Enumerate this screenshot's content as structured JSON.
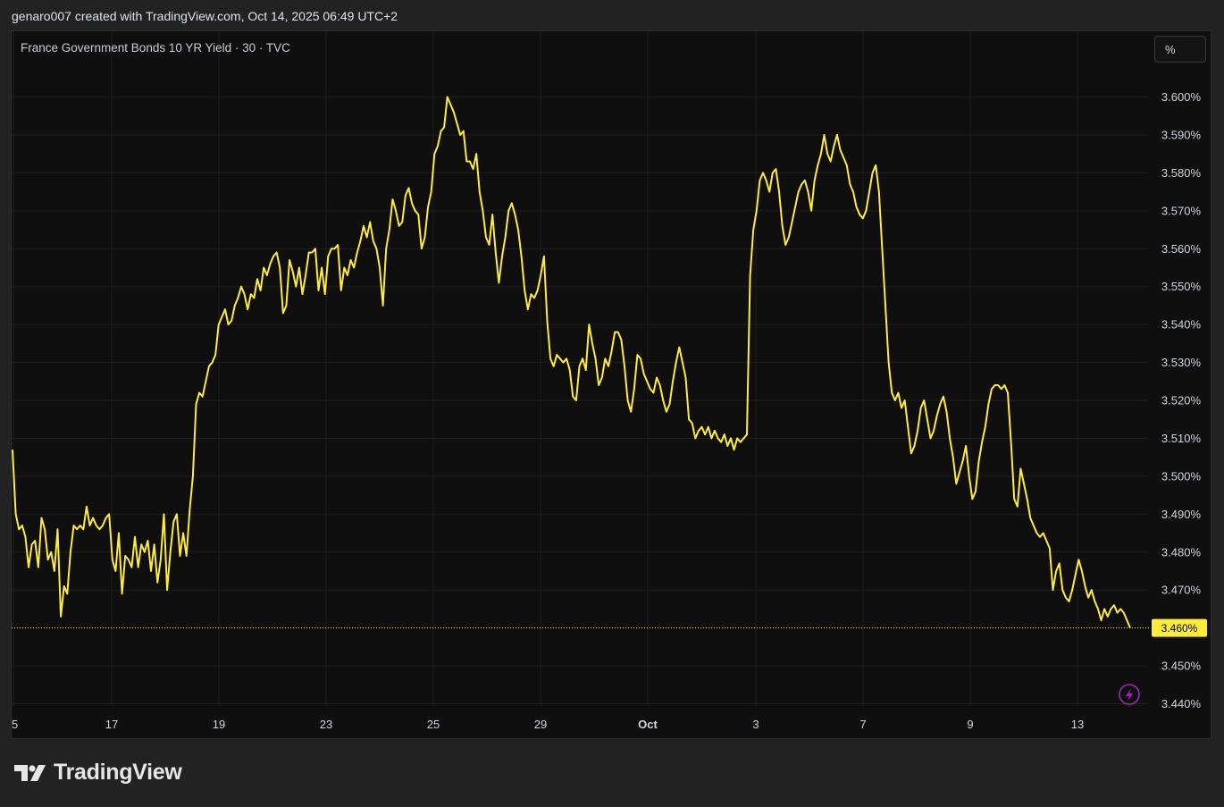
{
  "header": {
    "attribution": "genaro007 created with TradingView.com, Oct 14, 2025 06:49 UTC+2"
  },
  "legend": {
    "series_title": "France Government Bonds 10 YR Yield · 30 · TVC"
  },
  "controls": {
    "unit_label": "%"
  },
  "footer": {
    "logo_text": "TradingView",
    "logo_icon": "tradingview-logo-icon"
  },
  "colors": {
    "background": "#0f0f0f",
    "page": "#222222",
    "line": "#ffeb3b",
    "grid": "#1e1e1e",
    "badge_text": "#000000",
    "lightning": "#9c27b0"
  },
  "icons": {
    "realtime": "lightning-icon"
  },
  "chart_data": {
    "type": "line",
    "title": "France Government Bonds 10 YR Yield · 30 · TVC",
    "x_ticks": [
      "5",
      "17",
      "19",
      "23",
      "25",
      "29",
      "Oct",
      "3",
      "7",
      "9",
      "13"
    ],
    "y_ticks": [
      "3.600%",
      "3.590%",
      "3.580%",
      "3.570%",
      "3.560%",
      "3.550%",
      "3.540%",
      "3.530%",
      "3.520%",
      "3.510%",
      "3.500%",
      "3.490%",
      "3.480%",
      "3.470%",
      "3.450%",
      "3.440%"
    ],
    "ylim": [
      3.44,
      3.6
    ],
    "last_value": 3.46,
    "last_value_label": "3.460%",
    "grid": true,
    "series": [
      {
        "values": [
          3.507,
          3.49,
          3.486,
          3.487,
          3.484,
          3.476,
          3.482,
          3.483,
          3.476,
          3.489,
          3.486,
          3.478,
          3.48,
          3.475,
          3.486,
          3.463,
          3.471,
          3.469,
          3.48,
          3.487,
          3.486,
          3.487,
          3.486,
          3.492,
          3.487,
          3.489,
          3.487,
          3.486,
          3.487,
          3.489,
          3.49,
          3.478,
          3.475,
          3.485,
          3.469,
          3.479,
          3.478,
          3.476,
          3.484,
          3.476,
          3.482,
          3.48,
          3.483,
          3.475,
          3.482,
          3.472,
          3.478,
          3.49,
          3.47,
          3.48,
          3.488,
          3.49,
          3.479,
          3.485,
          3.479,
          3.491,
          3.5,
          3.519,
          3.522,
          3.521,
          3.525,
          3.529,
          3.53,
          3.532,
          3.54,
          3.542,
          3.544,
          3.54,
          3.541,
          3.545,
          3.547,
          3.55,
          3.548,
          3.544,
          3.548,
          3.547,
          3.552,
          3.549,
          3.555,
          3.553,
          3.556,
          3.558,
          3.559,
          3.555,
          3.543,
          3.545,
          3.557,
          3.554,
          3.55,
          3.555,
          3.548,
          3.553,
          3.559,
          3.559,
          3.56,
          3.549,
          3.555,
          3.548,
          3.558,
          3.56,
          3.56,
          3.561,
          3.549,
          3.555,
          3.553,
          3.557,
          3.555,
          3.559,
          3.562,
          3.566,
          3.563,
          3.567,
          3.562,
          3.56,
          3.555,
          3.545,
          3.56,
          3.565,
          3.573,
          3.57,
          3.566,
          3.567,
          3.574,
          3.576,
          3.572,
          3.57,
          3.569,
          3.56,
          3.563,
          3.571,
          3.575,
          3.585,
          3.587,
          3.591,
          3.592,
          3.6,
          3.598,
          3.596,
          3.593,
          3.59,
          3.591,
          3.583,
          3.583,
          3.581,
          3.585,
          3.575,
          3.57,
          3.563,
          3.561,
          3.569,
          3.559,
          3.551,
          3.558,
          3.563,
          3.57,
          3.572,
          3.569,
          3.565,
          3.558,
          3.549,
          3.544,
          3.548,
          3.547,
          3.549,
          3.553,
          3.558,
          3.541,
          3.531,
          3.529,
          3.532,
          3.531,
          3.53,
          3.531,
          3.528,
          3.521,
          3.52,
          3.529,
          3.531,
          3.528,
          3.54,
          3.535,
          3.531,
          3.524,
          3.526,
          3.531,
          3.529,
          3.533,
          3.538,
          3.538,
          3.536,
          3.529,
          3.52,
          3.517,
          3.523,
          3.532,
          3.531,
          3.527,
          3.525,
          3.523,
          3.522,
          3.526,
          3.524,
          3.52,
          3.517,
          3.519,
          3.525,
          3.53,
          3.534,
          3.53,
          3.526,
          3.515,
          3.514,
          3.51,
          3.512,
          3.513,
          3.511,
          3.513,
          3.51,
          3.512,
          3.51,
          3.509,
          3.511,
          3.508,
          3.51,
          3.507,
          3.51,
          3.509,
          3.51,
          3.511,
          3.553,
          3.565,
          3.57,
          3.578,
          3.58,
          3.578,
          3.575,
          3.58,
          3.581,
          3.575,
          3.566,
          3.561,
          3.563,
          3.567,
          3.571,
          3.575,
          3.577,
          3.578,
          3.575,
          3.57,
          3.578,
          3.582,
          3.585,
          3.59,
          3.585,
          3.583,
          3.587,
          3.59,
          3.586,
          3.584,
          3.582,
          3.577,
          3.575,
          3.571,
          3.569,
          3.568,
          3.57,
          3.575,
          3.58,
          3.582,
          3.575,
          3.56,
          3.545,
          3.53,
          3.522,
          3.52,
          3.522,
          3.518,
          3.52,
          3.513,
          3.506,
          3.508,
          3.512,
          3.518,
          3.52,
          3.515,
          3.51,
          3.512,
          3.516,
          3.519,
          3.521,
          3.517,
          3.51,
          3.505,
          3.498,
          3.501,
          3.504,
          3.508,
          3.5,
          3.494,
          3.496,
          3.504,
          3.509,
          3.513,
          3.519,
          3.523,
          3.524,
          3.524,
          3.523,
          3.524,
          3.522,
          3.509,
          3.494,
          3.492,
          3.502,
          3.498,
          3.494,
          3.489,
          3.487,
          3.485,
          3.484,
          3.485,
          3.483,
          3.481,
          3.47,
          3.475,
          3.477,
          3.47,
          3.468,
          3.467,
          3.47,
          3.474,
          3.478,
          3.475,
          3.471,
          3.468,
          3.47,
          3.467,
          3.465,
          3.462,
          3.465,
          3.463,
          3.465,
          3.466,
          3.464,
          3.465,
          3.464,
          3.462,
          3.46
        ]
      }
    ]
  }
}
